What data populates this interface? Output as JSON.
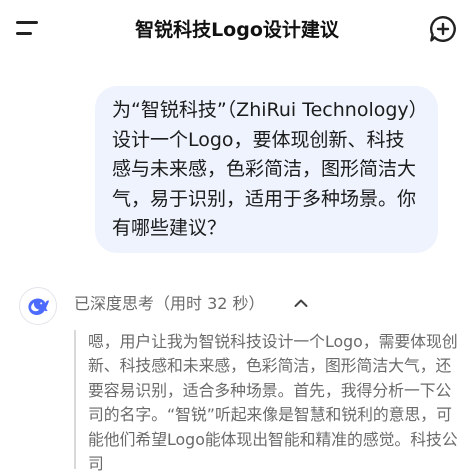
{
  "header": {
    "title": "智锐科技Logo设计建议",
    "menu_icon": "menu-icon",
    "new_chat_icon": "new-chat-icon"
  },
  "user_message": {
    "text": "为“智锐科技”（ZhiRui Technology）设计一个Logo，要体现创新、科技感与未来感，色彩简洁，图形简洁大气，易于识别，适用于多种场景。你有哪些建议？"
  },
  "assistant": {
    "avatar_icon": "whale-logo-icon",
    "thinking_label": "已深度思考（用时 32 秒）",
    "collapse_icon": "chevron-up-icon",
    "thinking_text": "嗯，用户让我为智锐科技设计一个Logo，需要体现创新、科技感和未来感，色彩简洁，图形简洁大气，还要容易识别，适合多种场景。首先，我得分析一下公司的名字。“智锐”听起来像是智慧和锐利的意思，可能他们希望Logo能体现出智能和精准的感觉。科技公司"
  },
  "colors": {
    "bubble_bg": "#eef3fd",
    "brand_blue": "#4d6bfe",
    "muted_text": "#6b6b6b"
  }
}
